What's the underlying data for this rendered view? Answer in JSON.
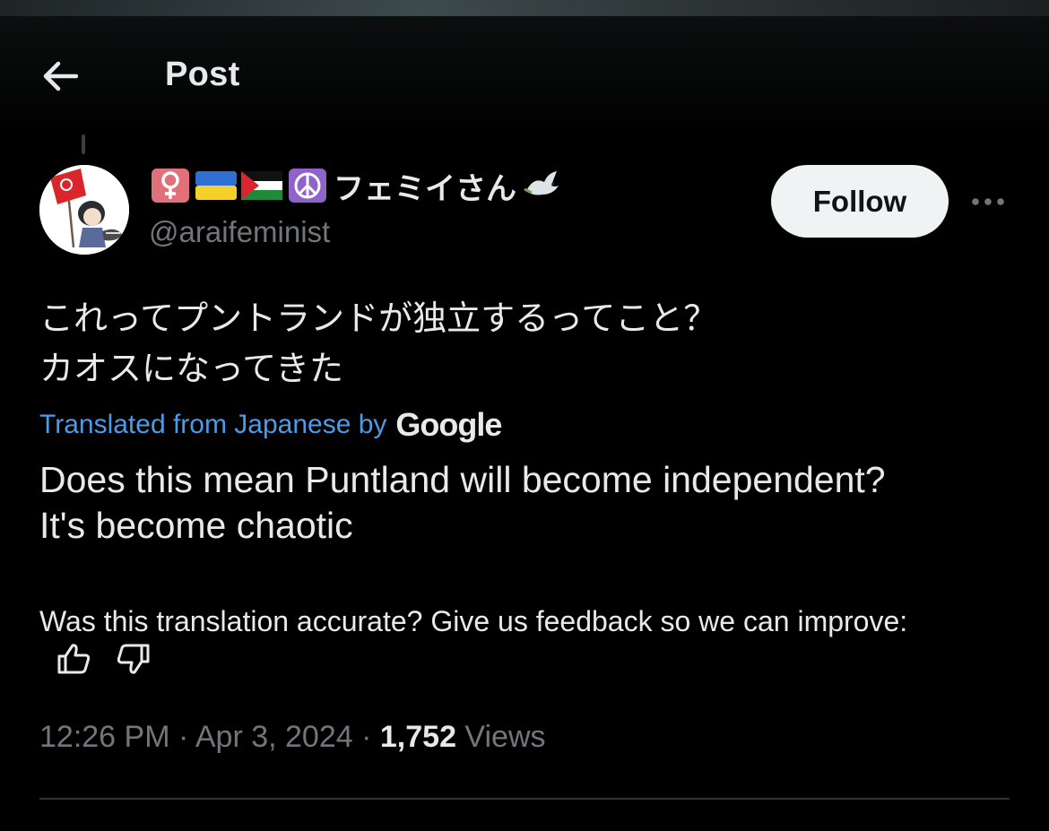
{
  "header": {
    "title": "Post",
    "back_icon": "arrow-left-icon"
  },
  "author": {
    "badges": [
      "female-sign-icon",
      "ukraine-flag-icon",
      "palestine-flag-icon",
      "peace-symbol-icon"
    ],
    "display_name": "フェミイさん",
    "dove_icon": "dove-icon",
    "handle": "@araifeminist",
    "follow_label": "Follow",
    "more_icon": "more-horizontal-icon"
  },
  "post": {
    "original_line1": "これってプントランドが独立するってこと？",
    "original_line2": "カオスになってきた",
    "translated_label": "Translated from Japanese by",
    "translator": "Google",
    "translation_line1": "Does this mean Puntland will become independent?",
    "translation_line2": "It's become chaotic",
    "feedback_text": "Was this translation accurate? Give us feedback so we can improve:",
    "timestamp": "12:26 PM · Apr 3, 2024 · ",
    "views_count": "1,752",
    "views_label": " Views"
  },
  "colors": {
    "background": "#000000",
    "text": "#e7e9ea",
    "muted": "#71767b",
    "link": "#4d9be6",
    "follow_bg": "#eff3f4"
  }
}
